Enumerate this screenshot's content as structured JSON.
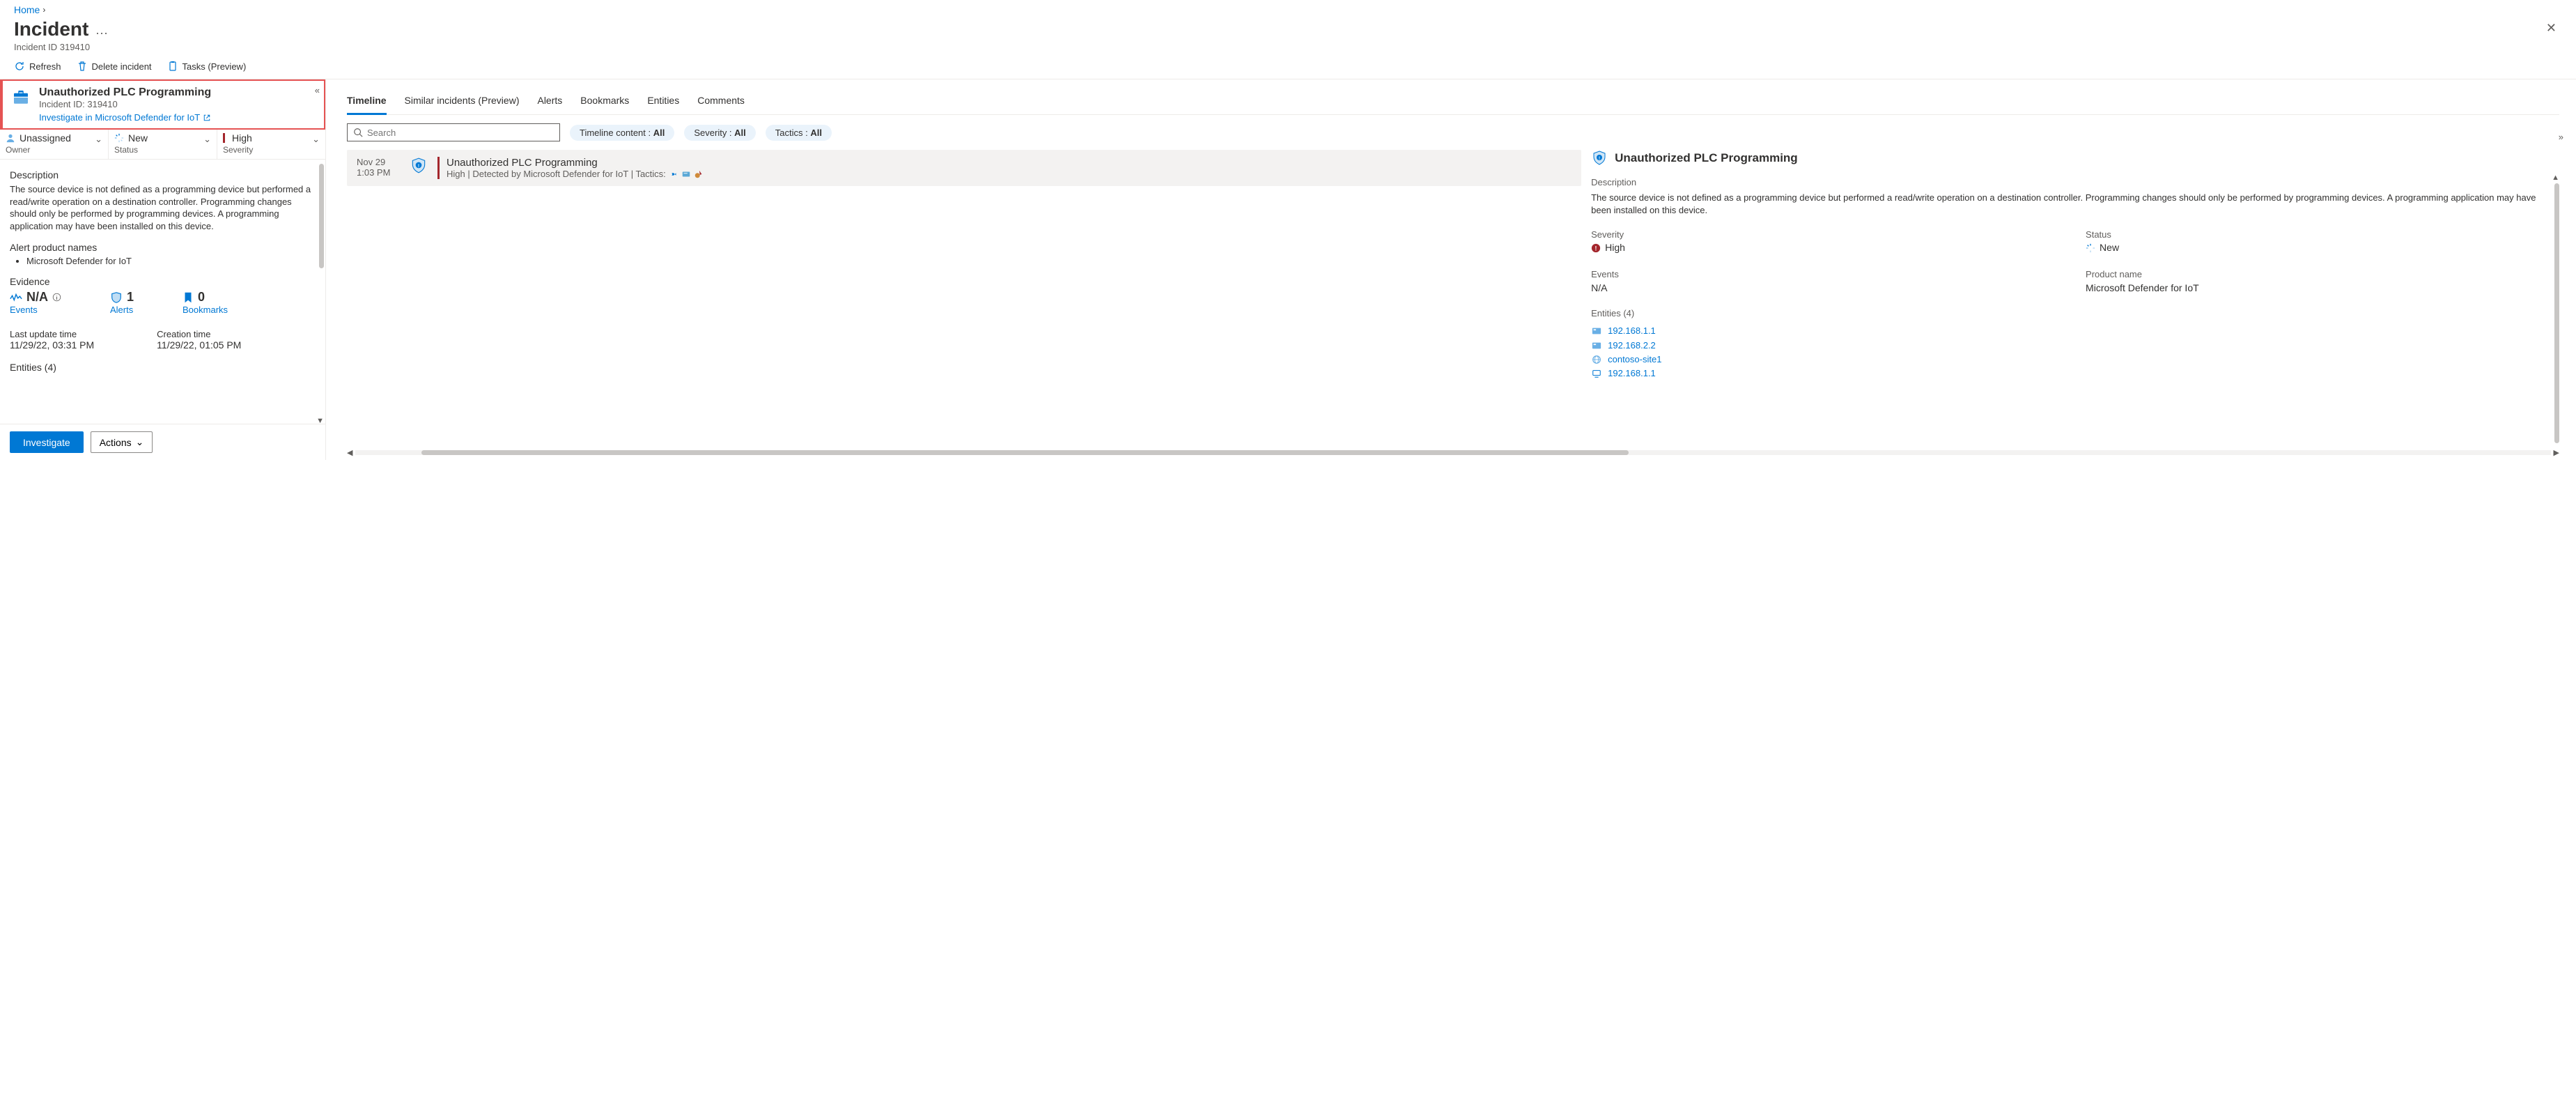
{
  "breadcrumb": {
    "home": "Home"
  },
  "page": {
    "title": "Incident",
    "subtitle": "Incident ID 319410"
  },
  "toolbar": {
    "refresh": "Refresh",
    "delete": "Delete incident",
    "tasks": "Tasks (Preview)"
  },
  "incident_card": {
    "title": "Unauthorized PLC Programming",
    "id_line": "Incident ID: 319410",
    "investigate_link": "Investigate in Microsoft Defender for IoT"
  },
  "status_row": {
    "owner": {
      "value": "Unassigned",
      "label": "Owner"
    },
    "status": {
      "value": "New",
      "label": "Status"
    },
    "severity": {
      "value": "High",
      "label": "Severity"
    }
  },
  "left_details": {
    "description_label": "Description",
    "description_text": "The source device is not defined as a programming device but performed a read/write operation on a destination controller. Programming changes should only be performed by programming devices. A programming application may have been installed on this device.",
    "alert_products_label": "Alert product names",
    "alert_products": [
      "Microsoft Defender for IoT"
    ],
    "evidence_label": "Evidence",
    "evidence": {
      "events": {
        "value": "N/A",
        "label": "Events"
      },
      "alerts": {
        "value": "1",
        "label": "Alerts"
      },
      "bookmarks": {
        "value": "0",
        "label": "Bookmarks"
      }
    },
    "last_update_label": "Last update time",
    "last_update_value": "11/29/22, 03:31 PM",
    "creation_label": "Creation time",
    "creation_value": "11/29/22, 01:05 PM",
    "entities_label": "Entities (4)"
  },
  "footer": {
    "investigate": "Investigate",
    "actions": "Actions"
  },
  "tabs": {
    "timeline": "Timeline",
    "similar": "Similar incidents (Preview)",
    "alerts": "Alerts",
    "bookmarks": "Bookmarks",
    "entities": "Entities",
    "comments": "Comments"
  },
  "filters": {
    "search_placeholder": "Search",
    "timeline_content": {
      "label": "Timeline content : ",
      "value": "All"
    },
    "severity": {
      "label": "Severity : ",
      "value": "All"
    },
    "tactics": {
      "label": "Tactics : ",
      "value": "All"
    }
  },
  "timeline_item": {
    "date": "Nov 29",
    "time": "1:03 PM",
    "title": "Unauthorized PLC Programming",
    "meta": "High | Detected by Microsoft Defender for IoT | Tactics:"
  },
  "detail": {
    "title": "Unauthorized PLC Programming",
    "description_label": "Description",
    "description_text": "The source device is not defined as a programming device but performed a read/write operation on a destination controller. Programming changes should only be performed by programming devices. A programming application may have been installed on this device.",
    "severity_label": "Severity",
    "severity_value": "High",
    "status_label": "Status",
    "status_value": "New",
    "events_label": "Events",
    "events_value": "N/A",
    "product_label": "Product name",
    "product_value": "Microsoft Defender for IoT",
    "entities_label": "Entities (4)",
    "entities": [
      {
        "type": "ip",
        "text": "192.168.1.1"
      },
      {
        "type": "ip",
        "text": "192.168.2.2"
      },
      {
        "type": "site",
        "text": "contoso-site1"
      },
      {
        "type": "device",
        "text": "192.168.1.1"
      }
    ]
  }
}
